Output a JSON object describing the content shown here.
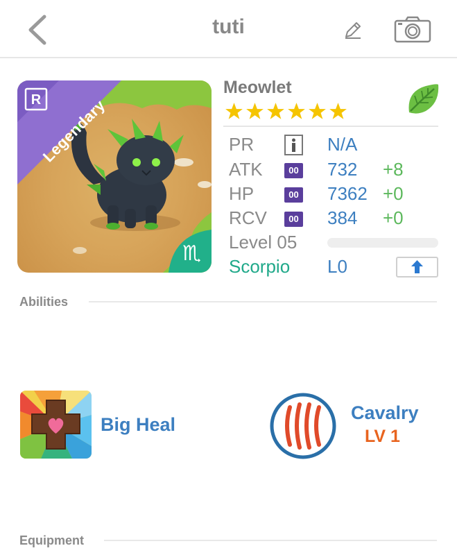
{
  "header": {
    "title": "tuti",
    "back_icon": "chevron-left-icon",
    "edit_icon": "pencil-icon",
    "camera_icon": "camera-icon"
  },
  "monster": {
    "rarity": "Legendary",
    "rarity_badge": "R",
    "zodiac_symbol": "♏",
    "name": "Meowlet",
    "stars": 6,
    "element_icon": "leaf-icon"
  },
  "stats": {
    "pr": {
      "label": "PR",
      "value": "N/A"
    },
    "atk": {
      "label": "ATK",
      "badge": "00",
      "value": "732",
      "bonus": "+8"
    },
    "hp": {
      "label": "HP",
      "badge": "00",
      "value": "7362",
      "bonus": "+0"
    },
    "rcv": {
      "label": "RCV",
      "badge": "00",
      "value": "384",
      "bonus": "+0"
    },
    "level_label": "Level 05",
    "level_progress": 0,
    "zodiac": "Scorpio",
    "zodiac_level": "L0"
  },
  "sections": {
    "abilities": "Abilities",
    "equipment": "Equipment"
  },
  "abilities": {
    "primary": {
      "name": "Big Heal",
      "icon": "heal-cross-icon"
    },
    "secondary": {
      "name": "Cavalry",
      "level": "LV 1",
      "icon": "claw-icon"
    }
  },
  "colors": {
    "accent_blue": "#3d7fc0",
    "bonus_green": "#5cb85c",
    "zodiac_teal": "#20a98a",
    "level_orange": "#e8641f",
    "rarity_purple": "#8f6fd0"
  }
}
